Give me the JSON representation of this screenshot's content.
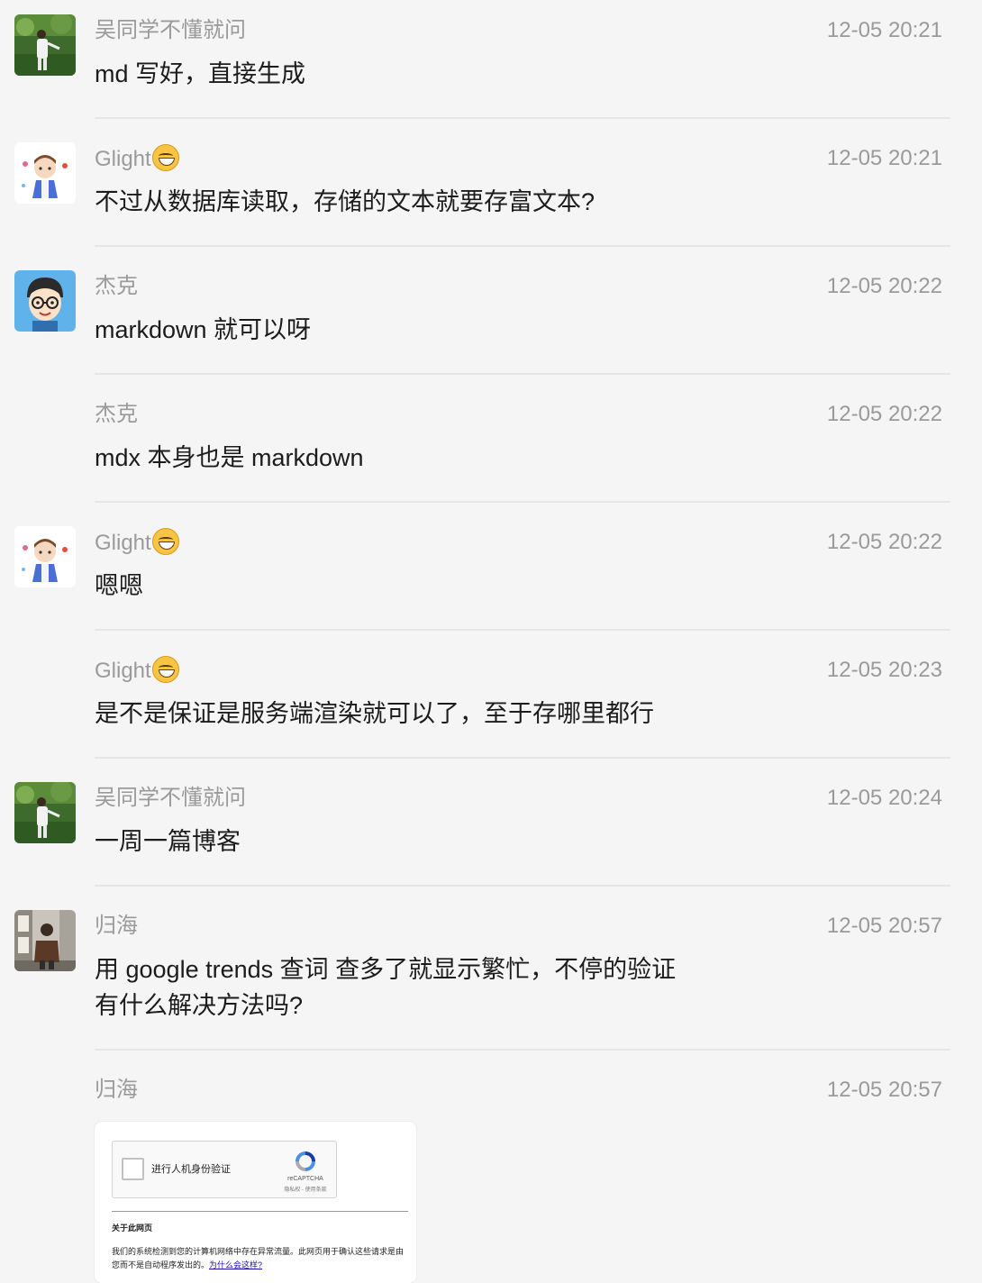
{
  "messages": [
    {
      "sender": "吴同学不懂就问",
      "time": "12-05 20:21",
      "text": "md 写好，直接生成",
      "avatar": "photo-landscape"
    },
    {
      "sender": "Glight",
      "time": "12-05 20:21",
      "text": "不过从数据库读取，存储的文本就要存富文本?",
      "avatar": "cartoon-boy",
      "emoji": "grinning-face"
    },
    {
      "sender": "杰克",
      "time": "12-05 20:22",
      "text": "markdown 就可以呀",
      "avatar": "cartoon-glasses"
    },
    {
      "sender": "杰克",
      "time": "12-05 20:22",
      "text": "mdx 本身也是 markdown"
    },
    {
      "sender": "Glight",
      "time": "12-05 20:22",
      "text": "嗯嗯",
      "avatar": "cartoon-boy",
      "emoji": "grinning-face"
    },
    {
      "sender": "Glight",
      "time": "12-05 20:23",
      "text": "是不是保证是服务端渲染就可以了，至于存哪里都行",
      "emoji": "grinning-face"
    },
    {
      "sender": "吴同学不懂就问",
      "time": "12-05 20:24",
      "text": "一周一篇博客",
      "avatar": "photo-landscape"
    },
    {
      "sender": "归海",
      "time": "12-05 20:57",
      "text": "用 google trends 查词 查多了就显示繁忙，不停的验证",
      "text2": "有什么解决方法吗?",
      "avatar": "photo-street"
    },
    {
      "sender": "归海",
      "time": "12-05 20:57"
    }
  ],
  "captcha": {
    "checkbox_label": "进行人机身份验证",
    "brand": "reCAPTCHA",
    "terms": "隐私权 - 使用条款",
    "about_title": "关于此网页",
    "about_body": "我们的系统检测到您的计算机网络中存在异常流量。此网页用于确认这些请求是由您而不是自动程序发出的。",
    "about_link": "为什么会这样?"
  }
}
